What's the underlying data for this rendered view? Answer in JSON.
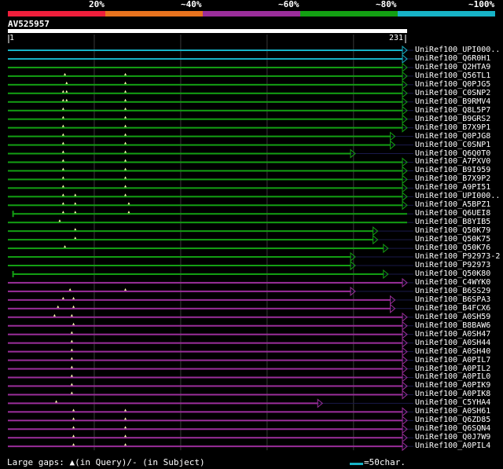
{
  "header": {
    "color_bands": [
      {
        "label": "20%",
        "color": "#ef1f3c"
      },
      {
        "label": "~40%",
        "color": "#e8731e"
      },
      {
        "label": "~60%",
        "color": "#9b2e9b"
      },
      {
        "label": "~80%",
        "color": "#13a013"
      },
      {
        "label": "~100%",
        "color": "#17b3c7"
      }
    ]
  },
  "query": {
    "id": "AV525957",
    "start": "1",
    "end": "231"
  },
  "legend": {
    "gaps_text": "Large gaps: ▲(in Query)/- (in Subject)",
    "scale_text": "=50char."
  },
  "hits": [
    {
      "label": "UniRef100_UPI000..",
      "color": "#17b3c7",
      "start": 1,
      "end": 231,
      "arrow": true,
      "query_gaps": []
    },
    {
      "label": "UniRef100_Q6R0H1",
      "color": "#17b3c7",
      "start": 1,
      "end": 231,
      "arrow": true,
      "query_gaps": []
    },
    {
      "label": "UniRef100_Q2HTA9",
      "color": "#13a013",
      "start": 1,
      "end": 231,
      "arrow": true,
      "query_gaps": []
    },
    {
      "label": "UniRef100_Q56TL1",
      "color": "#13a013",
      "start": 1,
      "end": 231,
      "arrow": true,
      "query_gaps": [
        33,
        68
      ]
    },
    {
      "label": "UniRef100_Q0PJG5",
      "color": "#13a013",
      "start": 1,
      "end": 231,
      "arrow": true,
      "query_gaps": [
        34,
        68
      ]
    },
    {
      "label": "UniRef100_C0SNP2",
      "color": "#13a013",
      "start": 1,
      "end": 231,
      "arrow": true,
      "query_gaps": [
        32,
        34,
        68
      ]
    },
    {
      "label": "UniRef100_B9RMV4",
      "color": "#13a013",
      "start": 1,
      "end": 231,
      "arrow": true,
      "query_gaps": [
        32,
        34,
        68
      ]
    },
    {
      "label": "UniRef100_Q8L5P7",
      "color": "#13a013",
      "start": 1,
      "end": 231,
      "arrow": true,
      "query_gaps": [
        32,
        68
      ]
    },
    {
      "label": "UniRef100_B9GRS2",
      "color": "#13a013",
      "start": 1,
      "end": 231,
      "arrow": true,
      "query_gaps": [
        32,
        68
      ]
    },
    {
      "label": "UniRef100_B7X9P1",
      "color": "#13a013",
      "start": 1,
      "end": 231,
      "arrow": true,
      "query_gaps": [
        32,
        68
      ]
    },
    {
      "label": "UniRef100_Q0PJG8",
      "color": "#13a013",
      "start": 1,
      "end": 224,
      "arrow": true,
      "query_gaps": [
        32,
        68
      ]
    },
    {
      "label": "UniRef100_C0SNP1",
      "color": "#13a013",
      "start": 1,
      "end": 224,
      "arrow": true,
      "query_gaps": [
        32,
        68
      ]
    },
    {
      "label": "UniRef100_Q6Q0T0",
      "color": "#13a013",
      "start": 1,
      "end": 201,
      "arrow": true,
      "query_gaps": [
        32,
        68
      ]
    },
    {
      "label": "UniRef100_A7PXV0",
      "color": "#13a013",
      "start": 1,
      "end": 231,
      "arrow": true,
      "query_gaps": [
        32,
        68
      ]
    },
    {
      "label": "UniRef100_B9I959",
      "color": "#13a013",
      "start": 1,
      "end": 231,
      "arrow": true,
      "query_gaps": [
        32,
        68
      ]
    },
    {
      "label": "UniRef100_B7X9P2",
      "color": "#13a013",
      "start": 1,
      "end": 231,
      "arrow": true,
      "query_gaps": [
        32,
        68
      ]
    },
    {
      "label": "UniRef100_A9PI51",
      "color": "#13a013",
      "start": 1,
      "end": 231,
      "arrow": true,
      "query_gaps": [
        32,
        68
      ]
    },
    {
      "label": "UniRef100_UPI000..",
      "color": "#13a013",
      "start": 1,
      "end": 231,
      "arrow": true,
      "query_gaps": [
        32,
        39,
        68
      ]
    },
    {
      "label": "UniRef100_A5BPZ1",
      "color": "#13a013",
      "start": 1,
      "end": 231,
      "arrow": true,
      "query_gaps": [
        32,
        39,
        70
      ]
    },
    {
      "label": "UniRef100_Q6UEI8",
      "color": "#13a013",
      "start": 4,
      "end": 231,
      "arrow": false,
      "query_gaps": [
        32,
        39,
        70
      ]
    },
    {
      "label": "UniRef100_B8YIB5",
      "color": "#13a013",
      "start": 1,
      "end": 231,
      "arrow": false,
      "query_gaps": [
        30
      ]
    },
    {
      "label": "UniRef100_Q50K79",
      "color": "#13a013",
      "start": 1,
      "end": 214,
      "arrow": true,
      "query_gaps": [
        39
      ]
    },
    {
      "label": "UniRef100_Q50K75",
      "color": "#13a013",
      "start": 1,
      "end": 214,
      "arrow": true,
      "query_gaps": [
        39
      ]
    },
    {
      "label": "UniRef100_Q50K76",
      "color": "#13a013",
      "start": 1,
      "end": 220,
      "arrow": true,
      "query_gaps": [
        33
      ]
    },
    {
      "label": "UniRef100_P92973-2",
      "color": "#13a013",
      "start": 1,
      "end": 201,
      "arrow": true,
      "query_gaps": []
    },
    {
      "label": "UniRef100_P92973",
      "color": "#13a013",
      "start": 1,
      "end": 201,
      "arrow": true,
      "query_gaps": []
    },
    {
      "label": "UniRef100_Q50K80",
      "color": "#13a013",
      "start": 4,
      "end": 220,
      "arrow": true,
      "query_gaps": []
    },
    {
      "label": "UniRef100_C4WYK0",
      "color": "#9b2e9b",
      "start": 1,
      "end": 231,
      "arrow": true,
      "query_gaps": []
    },
    {
      "label": "UniRef100_B6SS29",
      "color": "#9b2e9b",
      "start": 1,
      "end": 201,
      "arrow": true,
      "query_gaps": [
        36,
        68
      ]
    },
    {
      "label": "UniRef100_B6SPA3",
      "color": "#9b2e9b",
      "start": 1,
      "end": 224,
      "arrow": true,
      "query_gaps": [
        32,
        38
      ]
    },
    {
      "label": "UniRef100_B4FCX6",
      "color": "#9b2e9b",
      "start": 1,
      "end": 224,
      "arrow": true,
      "query_gaps": [
        29,
        38
      ]
    },
    {
      "label": "UniRef100_A0SH59",
      "color": "#9b2e9b",
      "start": 1,
      "end": 231,
      "arrow": true,
      "query_gaps": [
        27,
        37
      ]
    },
    {
      "label": "UniRef100_B8BAW6",
      "color": "#9b2e9b",
      "start": 1,
      "end": 231,
      "arrow": true,
      "query_gaps": [
        38
      ]
    },
    {
      "label": "UniRef100_A0SH47",
      "color": "#9b2e9b",
      "start": 1,
      "end": 231,
      "arrow": true,
      "query_gaps": [
        37
      ]
    },
    {
      "label": "UniRef100_A0SH44",
      "color": "#9b2e9b",
      "start": 1,
      "end": 231,
      "arrow": true,
      "query_gaps": [
        37
      ]
    },
    {
      "label": "UniRef100_A0SH40",
      "color": "#9b2e9b",
      "start": 1,
      "end": 231,
      "arrow": true,
      "query_gaps": [
        37
      ]
    },
    {
      "label": "UniRef100_A0PIL7",
      "color": "#9b2e9b",
      "start": 1,
      "end": 231,
      "arrow": true,
      "query_gaps": [
        37
      ]
    },
    {
      "label": "UniRef100_A0PIL2",
      "color": "#9b2e9b",
      "start": 1,
      "end": 231,
      "arrow": true,
      "query_gaps": [
        37
      ]
    },
    {
      "label": "UniRef100_A0PIL0",
      "color": "#9b2e9b",
      "start": 1,
      "end": 231,
      "arrow": true,
      "query_gaps": [
        37
      ]
    },
    {
      "label": "UniRef100_A0PIK9",
      "color": "#9b2e9b",
      "start": 1,
      "end": 231,
      "arrow": true,
      "query_gaps": [
        37
      ]
    },
    {
      "label": "UniRef100_A0PIK8",
      "color": "#9b2e9b",
      "start": 1,
      "end": 231,
      "arrow": true,
      "query_gaps": [
        37
      ]
    },
    {
      "label": "UniRef100_C5YHA4",
      "color": "#9b2e9b",
      "start": 1,
      "end": 182,
      "arrow": true,
      "query_gaps": [
        28
      ]
    },
    {
      "label": "UniRef100_A0SH61",
      "color": "#9b2e9b",
      "start": 1,
      "end": 231,
      "arrow": true,
      "query_gaps": [
        38,
        68
      ]
    },
    {
      "label": "UniRef100_Q6ZD85",
      "color": "#9b2e9b",
      "start": 1,
      "end": 231,
      "arrow": true,
      "query_gaps": [
        38,
        68
      ]
    },
    {
      "label": "UniRef100_Q6SQN4",
      "color": "#9b2e9b",
      "start": 1,
      "end": 231,
      "arrow": true,
      "query_gaps": [
        38,
        68
      ]
    },
    {
      "label": "UniRef100_Q0J7W9",
      "color": "#9b2e9b",
      "start": 1,
      "end": 231,
      "arrow": true,
      "query_gaps": [
        38,
        68
      ]
    },
    {
      "label": "UniRef100_A0PIL4",
      "color": "#9b2e9b",
      "start": 1,
      "end": 231,
      "arrow": true,
      "query_gaps": [
        38,
        68
      ]
    }
  ]
}
